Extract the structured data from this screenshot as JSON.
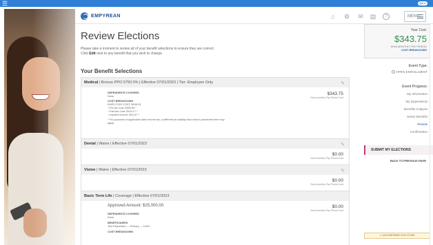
{
  "topbar": {
    "menu_glyph": "☰",
    "badge": "QA ●"
  },
  "brand": {
    "name": "EMPYREAN"
  },
  "header": {
    "icons": [
      "home-icon",
      "settings-icon",
      "messages-icon",
      "documents-icon",
      "help-icon"
    ],
    "home_glyph": "⌂",
    "settings_glyph": "⚙",
    "messages_glyph": "✉",
    "documents_glyph": "▤",
    "help_glyph": "?",
    "menu_label": "MENU"
  },
  "page": {
    "title": "Review Elections",
    "intro_line1": "Please take a moment to review all of your benefit selections to ensure they are correct.",
    "intro_click": "Click ",
    "intro_edit": "Edit",
    "intro_line2_rest": " next to any benefit that you wish to change.",
    "section_title": "Your Benefit Selections"
  },
  "benefits": {
    "medical": {
      "name": "Medical",
      "summary": " | Bronze PPO 5750 0% | Effective 07/01/2023 | Tier: Employee Only",
      "cost": "$343.75",
      "cost_label": "Semi-monthly Pay Period Cost",
      "dependents_header": "DEPENDENTS COVERED",
      "dependents": "None",
      "breakdown_header": "COST BREAKDOWN",
      "employer_cost": "EMPLOYER COST: $258.33",
      "pretax": "Pre-tax Cost: $339.55 *",
      "posttax": "Post-tax Cost: $104.17 *",
      "imputed": "Imputed Income: $41.67 *",
      "note": "* For purposes of applicable state income tax, a different tax liability than what is presented here may",
      "note2": "apply."
    },
    "dental": {
      "name": "Dental",
      "summary": " | Waive | Effective 07/01/2023",
      "cost": "$0.00",
      "cost_label": "Semi-monthly Pay Period Cost"
    },
    "vision": {
      "name": "Vision",
      "summary": " | Waive | Effective 07/01/2023",
      "cost": "$0.00",
      "cost_label": "Semi-monthly Pay Period Cost"
    },
    "life": {
      "name": "Basic Term Life",
      "summary": " | Coverage | Effective 07/01/2023",
      "approved": "Approved Amount: $25,000.00",
      "cost": "$0.00",
      "cost_label": "Semi-monthly Pay Period Cost",
      "dependents_header": "DEPENDENTS COVERED",
      "dependents": "None",
      "beneficiaries_header": "BENEFICIARIES",
      "beneficiary": "Test Dependent — Primary — 100%",
      "breakdown_header": "COST BREAKDOWN"
    }
  },
  "sidebar": {
    "your_cost_label": "Your Cost:",
    "your_cost": "$343.75",
    "period": "SEMI-MONTHLY PAY PERIOD",
    "breakdown_link": "COST BREAKDOWN",
    "event_type_label": "Event Type:",
    "event_type": "OPEN ENROLLMENT",
    "progress_label": "Event Progress:",
    "steps": [
      "My Information",
      "My Dependents",
      "Benefits Analysis",
      "Select Benefits",
      "Review",
      "Confirmation"
    ],
    "submit": "SUBMIT MY ELECTIONS",
    "back": "BACK TO PREVIOUS PAGE",
    "unconfirmed": "⚠ UNCONFIRMED ELECTIONS"
  },
  "colors": {
    "accent": "#2f80d6",
    "cost_green": "#2e8b4a",
    "submit_accent": "#c0357a"
  }
}
